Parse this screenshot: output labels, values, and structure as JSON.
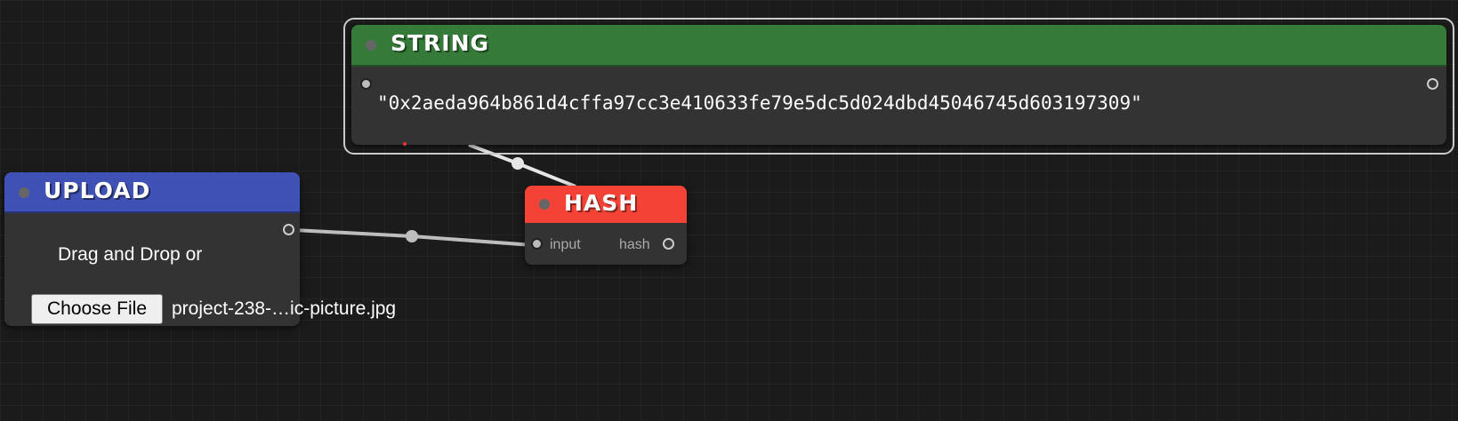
{
  "nodes": {
    "string": {
      "title": "STRING",
      "value": "\"0x2aeda964b861d4cffa97cc3e410633fe79e5dc5d024dbd45046745d603197309\"",
      "header_color": "#357a38"
    },
    "upload": {
      "title": "UPLOAD",
      "drag_text": "Drag and Drop or",
      "choose_file_label": "Choose File",
      "file_name": "project-238-…ic-picture.jpg",
      "header_color": "#3f51b5"
    },
    "hash": {
      "title": "HASH",
      "input_label": "input",
      "output_label": "hash",
      "header_color": "#f44336"
    }
  },
  "colors": {
    "canvas_background": "#1b1b1b",
    "node_body": "#333333",
    "wire": "#cccccc"
  }
}
